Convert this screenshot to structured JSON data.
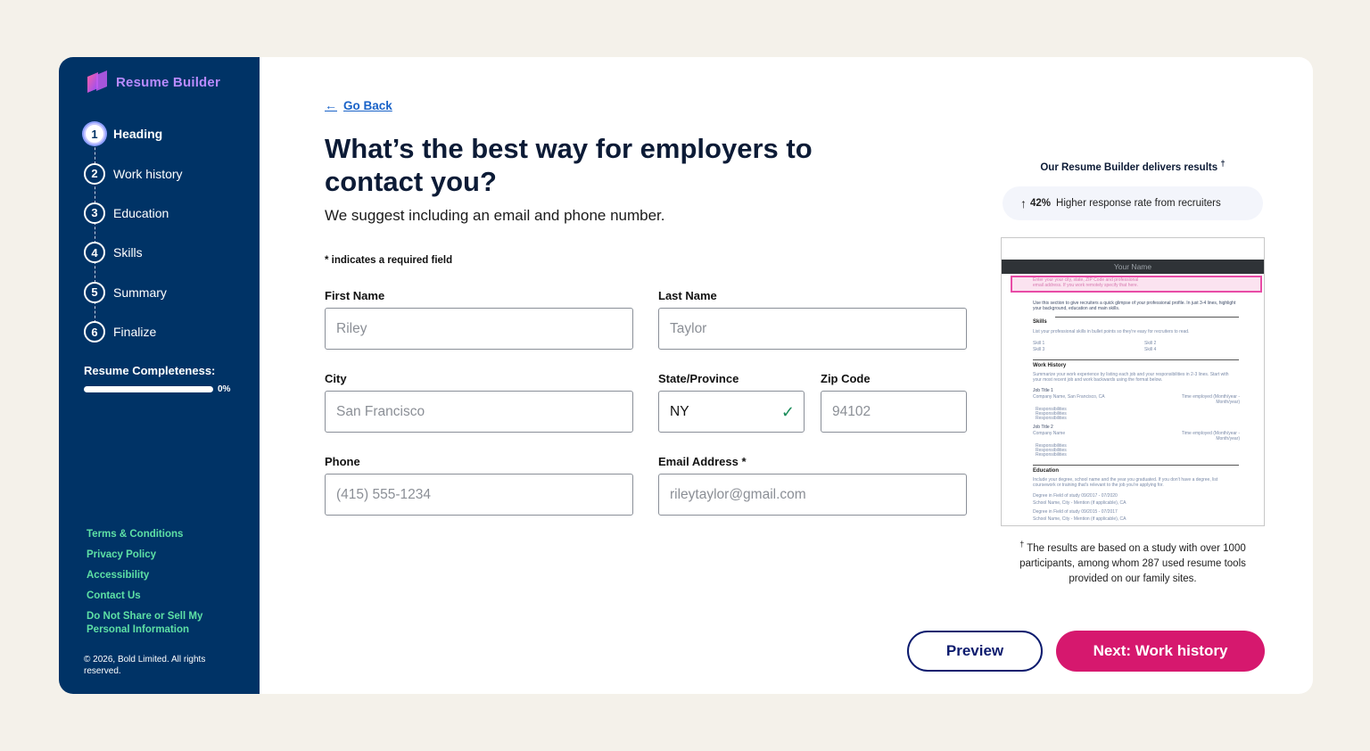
{
  "app": {
    "name": "Resume Builder"
  },
  "steps": [
    {
      "num": "1",
      "label": "Heading",
      "active": true
    },
    {
      "num": "2",
      "label": "Work history"
    },
    {
      "num": "3",
      "label": "Education"
    },
    {
      "num": "4",
      "label": "Skills"
    },
    {
      "num": "5",
      "label": "Summary"
    },
    {
      "num": "6",
      "label": "Finalize"
    }
  ],
  "completeness": {
    "title": "Resume Completeness:",
    "value": 0,
    "label": "0%"
  },
  "footer_links": [
    "Terms & Conditions",
    "Privacy Policy",
    "Accessibility",
    "Contact Us",
    "Do Not Share or Sell My Personal Information"
  ],
  "copyright": "© 2026, Bold Limited. All rights reserved.",
  "main": {
    "go_back": "Go Back",
    "title": "What’s the best way for employers to contact you?",
    "subtitle": "We suggest including an email and phone number.",
    "required_note": "* indicates a required field"
  },
  "fields": {
    "first_name": {
      "label": "First Name",
      "placeholder": "Riley"
    },
    "last_name": {
      "label": "Last Name",
      "placeholder": "Taylor"
    },
    "city": {
      "label": "City",
      "placeholder": "San Francisco"
    },
    "state": {
      "label": "State/Province",
      "value": "NY"
    },
    "zip": {
      "label": "Zip Code",
      "placeholder": "94102"
    },
    "phone": {
      "label": "Phone",
      "placeholder": "(415) 555-1234"
    },
    "email": {
      "label": "Email Address *",
      "placeholder": "rileytaylor@gmail.com"
    }
  },
  "panel": {
    "title": "Our Resume Builder delivers results",
    "title_mark": "†",
    "stat_pct": "42%",
    "stat_text": "Higher response rate from recruiters",
    "preview": {
      "name": "Your Name",
      "highlight_text": "Enter your your city, state, ZIP Code and professional email address. If you work remotely specify that here.",
      "intro": "Use this section to give recruiters a quick glimpse of your professional profile. In just 3-4 lines, highlight your background, education and main skills.",
      "skills_h": "Skills",
      "skills_text": "List your professional skills in bullet points so they're easy for recruiters to read.",
      "skill_items": [
        "Skill 1",
        "Skill 2",
        "Skill 3",
        "Skill 4"
      ],
      "work_h": "Work History",
      "work_text": "Summarize your work experience by listing each job and your responsibilities in 2-3 lines. Start with your most recent job and work backwards using the format below.",
      "job1_title": "Job Title 1",
      "job1_company": "Company Name, San Francisco, CA",
      "job1_dates": "Time employed (Month/year - Month/year)",
      "responsibility": "Responsibilities",
      "job2_title": "Job Title 2",
      "job2_company": "Company Name",
      "job2_dates": "Time employed (Month/year - Month/year)",
      "edu_h": "Education",
      "edu_text": "Include your degree, school name and the year you graduated. If you don't have a degree, list coursework or training that's relevant to the job you're applying for.",
      "edu1": "Degree in Field of study 09/2017 - 07/2020",
      "edu1_school": "School Name, City - Mention (if applicable), CA",
      "edu2": "Degree in Field of study 09/2015 - 07/2017",
      "edu2_school": "School Name, City - Mention (if applicable), CA"
    },
    "note_mark": "†",
    "note": "The results are based on a study with over 1000 participants, among whom 287 used resume tools provided on our family sites."
  },
  "buttons": {
    "preview": "Preview",
    "next": "Next: Work history"
  }
}
